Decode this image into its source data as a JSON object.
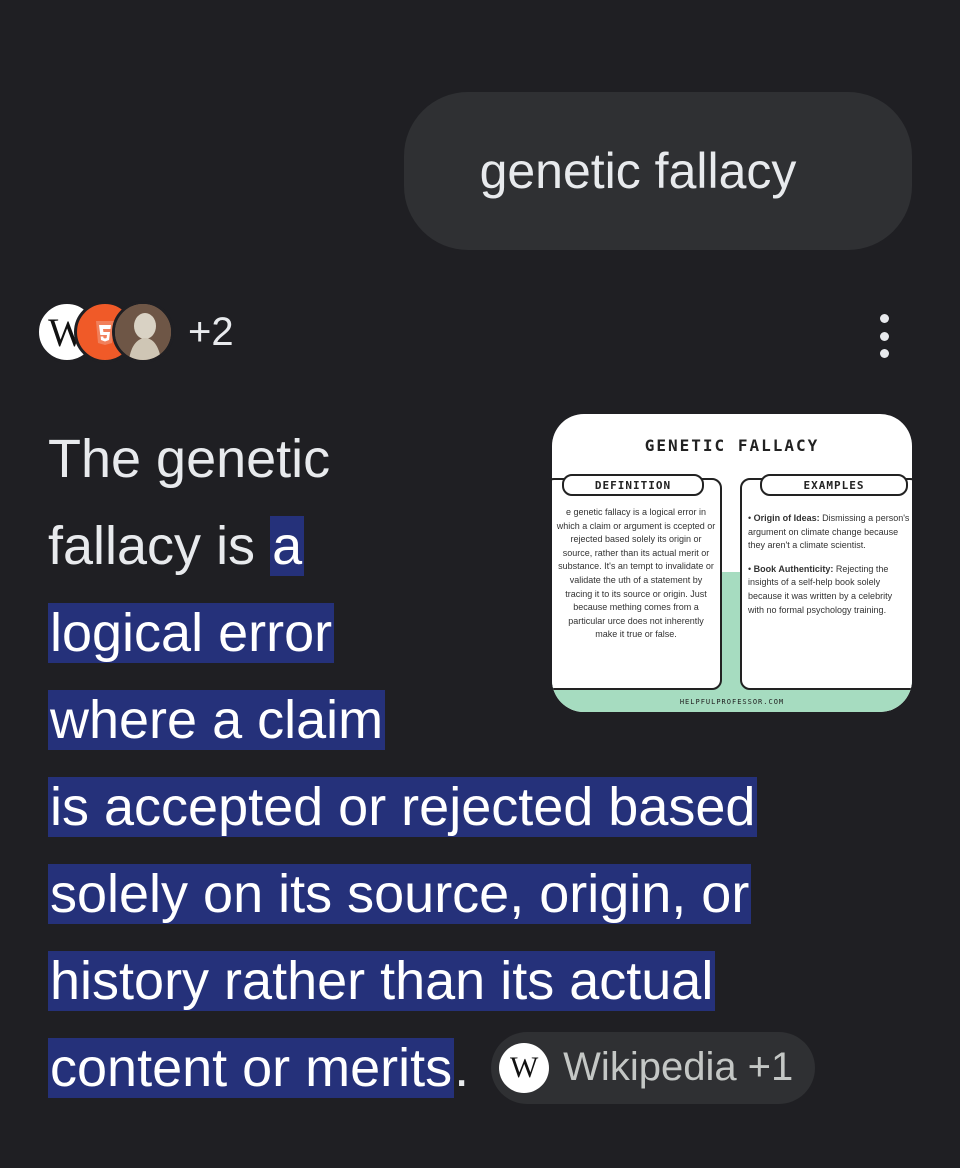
{
  "query": "genetic fallacy",
  "sources": {
    "icons": [
      {
        "name": "wikipedia",
        "glyph": "W"
      },
      {
        "name": "html5-orange",
        "glyph": ""
      },
      {
        "name": "statue-image",
        "glyph": ""
      }
    ],
    "more_count": "+2"
  },
  "thumbnail": {
    "title": "GENETIC FALLACY",
    "definition_label": "DEFINITION",
    "definition_text": "e genetic fallacy is a logical error in which a claim or argument is ccepted or rejected based solely its origin or source, rather than its actual merit or substance. It's an tempt to invalidate or validate the uth of a statement by tracing it to its source or origin. Just because mething comes from a particular urce does not inherently make it true or false.",
    "examples_label": "EXAMPLES",
    "examples": [
      {
        "heading": "Origin of Ideas:",
        "text": " Dismissing a person's argument on climate change because they aren't a climate scientist."
      },
      {
        "heading": "Book Authenticity:",
        "text": " Rejecting the insights of a self-help book solely because it was written by a celebrity with no formal psychology training."
      }
    ],
    "footer": "HELPFULPROFESSOR.COM"
  },
  "answer": {
    "lines": [
      {
        "plain": "The genetic",
        "hl": ""
      },
      {
        "plain": "fallacy is ",
        "hl": "a"
      },
      {
        "plain": "",
        "hl": "logical error"
      },
      {
        "plain": "",
        "hl": "where a claim"
      },
      {
        "plain": "",
        "hl": "is accepted or rejected based"
      },
      {
        "plain": "",
        "hl": "solely on its source, origin, or"
      },
      {
        "plain": "",
        "hl": "history rather than its actual"
      },
      {
        "plain": "",
        "hl": "content or merits"
      }
    ],
    "end_punct": ".",
    "citation": {
      "icon": "W",
      "label": "Wikipedia +1"
    }
  },
  "colors": {
    "background": "#1f1f23",
    "bubble": "#2f3033",
    "highlight": "#25317a",
    "accent_orange": "#f05a28",
    "thumb_band": "#a6dcc0"
  }
}
